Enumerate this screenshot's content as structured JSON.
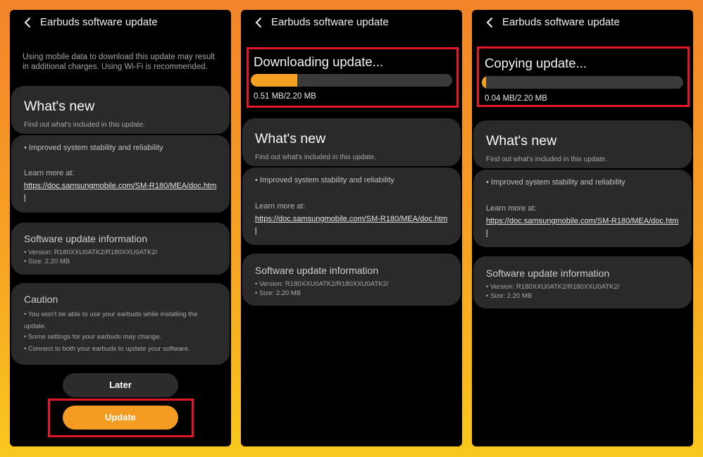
{
  "header": {
    "title": "Earbuds software update",
    "back_icon": "chevron-left-icon"
  },
  "colors": {
    "accent": "#f49b22",
    "highlight": "#e3162a",
    "card": "#2a2a2a"
  },
  "screen1": {
    "data_note": "Using mobile data to download this update may result in additional charges. Using Wi-Fi is recommended.",
    "later_label": "Later",
    "update_label": "Update"
  },
  "screen2": {
    "status": "Downloading update...",
    "progress": 0.232,
    "amount": "0.51 MB/2.20 MB"
  },
  "screen3": {
    "status": "Copying update...",
    "progress": 0.02,
    "amount": "0.04 MB/2.20 MB"
  },
  "whats_new": {
    "title": "What's new",
    "subtitle": "Find out what's included in this update.",
    "bullet": "• Improved system stability and reliability",
    "learn_more": "Learn more at:",
    "link": "https://doc.samsungmobile.com/SM-R180/MEA/doc.html"
  },
  "software_info": {
    "title": "Software update information",
    "version": "• Version: R180XXU0ATK2/R180XXU0ATK2/",
    "size": "• Size: 2.20 MB"
  },
  "caution": {
    "title": "Caution",
    "items": [
      "• You won't be able to use your earbuds while installing the update.",
      "• Some settings for your earbuds may change.",
      "• Connect to both your earbuds to update your software."
    ]
  }
}
